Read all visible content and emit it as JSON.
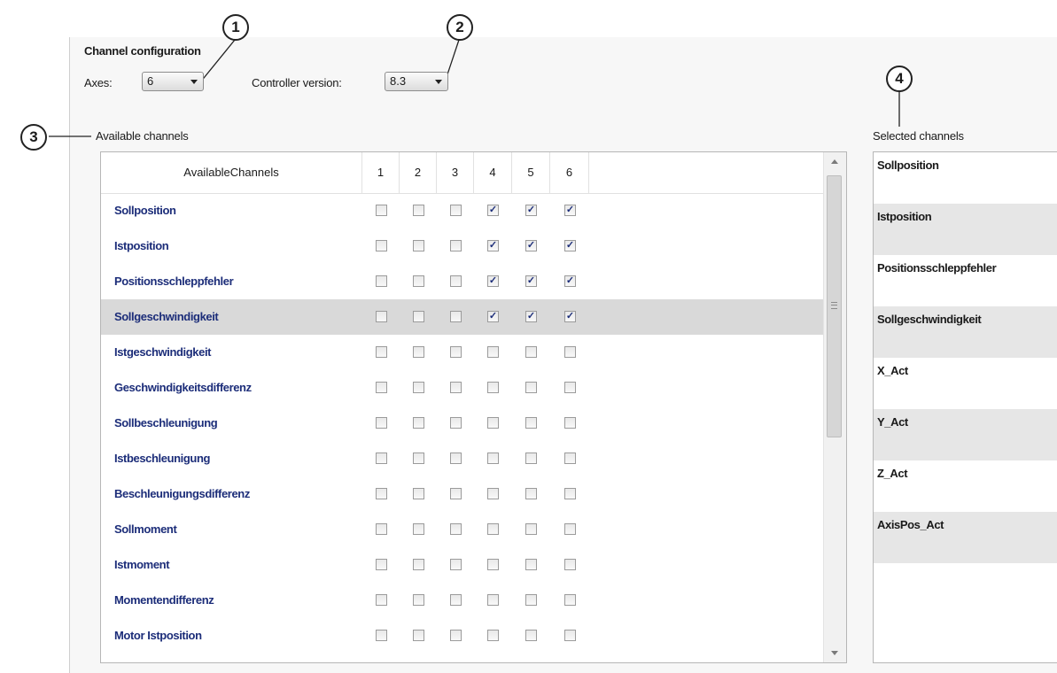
{
  "callouts": [
    "1",
    "2",
    "3",
    "4"
  ],
  "config": {
    "title": "Channel configuration",
    "axes_label": "Axes:",
    "axes_value": "6",
    "controller_label": "Controller version:",
    "controller_value": "8.3"
  },
  "available": {
    "label": "Available channels",
    "column_header": "AvailableChannels",
    "axis_headers": [
      "1",
      "2",
      "3",
      "4",
      "5",
      "6"
    ],
    "rows": [
      {
        "name": "Sollposition",
        "checks": [
          false,
          false,
          false,
          true,
          true,
          true
        ]
      },
      {
        "name": "Istposition",
        "checks": [
          false,
          false,
          false,
          true,
          true,
          true
        ]
      },
      {
        "name": "Positionsschleppfehler",
        "checks": [
          false,
          false,
          false,
          true,
          true,
          true
        ]
      },
      {
        "name": "Sollgeschwindigkeit",
        "checks": [
          false,
          false,
          false,
          true,
          true,
          true
        ],
        "selected": true
      },
      {
        "name": "Istgeschwindigkeit",
        "checks": [
          false,
          false,
          false,
          false,
          false,
          false
        ]
      },
      {
        "name": "Geschwindigkeitsdifferenz",
        "checks": [
          false,
          false,
          false,
          false,
          false,
          false
        ]
      },
      {
        "name": "Sollbeschleunigung",
        "checks": [
          false,
          false,
          false,
          false,
          false,
          false
        ]
      },
      {
        "name": "Istbeschleunigung",
        "checks": [
          false,
          false,
          false,
          false,
          false,
          false
        ]
      },
      {
        "name": "Beschleunigungsdifferenz",
        "checks": [
          false,
          false,
          false,
          false,
          false,
          false
        ]
      },
      {
        "name": "Sollmoment",
        "checks": [
          false,
          false,
          false,
          false,
          false,
          false
        ]
      },
      {
        "name": "Istmoment",
        "checks": [
          false,
          false,
          false,
          false,
          false,
          false
        ]
      },
      {
        "name": "Momentendifferenz",
        "checks": [
          false,
          false,
          false,
          false,
          false,
          false
        ]
      },
      {
        "name": "Motor Istposition",
        "checks": [
          false,
          false,
          false,
          false,
          false,
          false
        ]
      }
    ]
  },
  "selected": {
    "label": "Selected channels",
    "items": [
      "Sollposition",
      "Istposition",
      "Positionsschleppfehler",
      "Sollgeschwindigkeit",
      "X_Act",
      "Y_Act",
      "Z_Act",
      "AxisPos_Act"
    ]
  },
  "icons": {
    "checkbox_checked": "checkmark-icon",
    "dropdown": "dropdown-arrow-icon",
    "scroll_up": "scroll-up-icon",
    "scroll_down": "scroll-down-icon",
    "grip": "grip-icon"
  },
  "colors": {
    "channel_text": "#1c2d79",
    "selected_row": "#d9d9d9",
    "alt_row": "#e6e6e6"
  }
}
